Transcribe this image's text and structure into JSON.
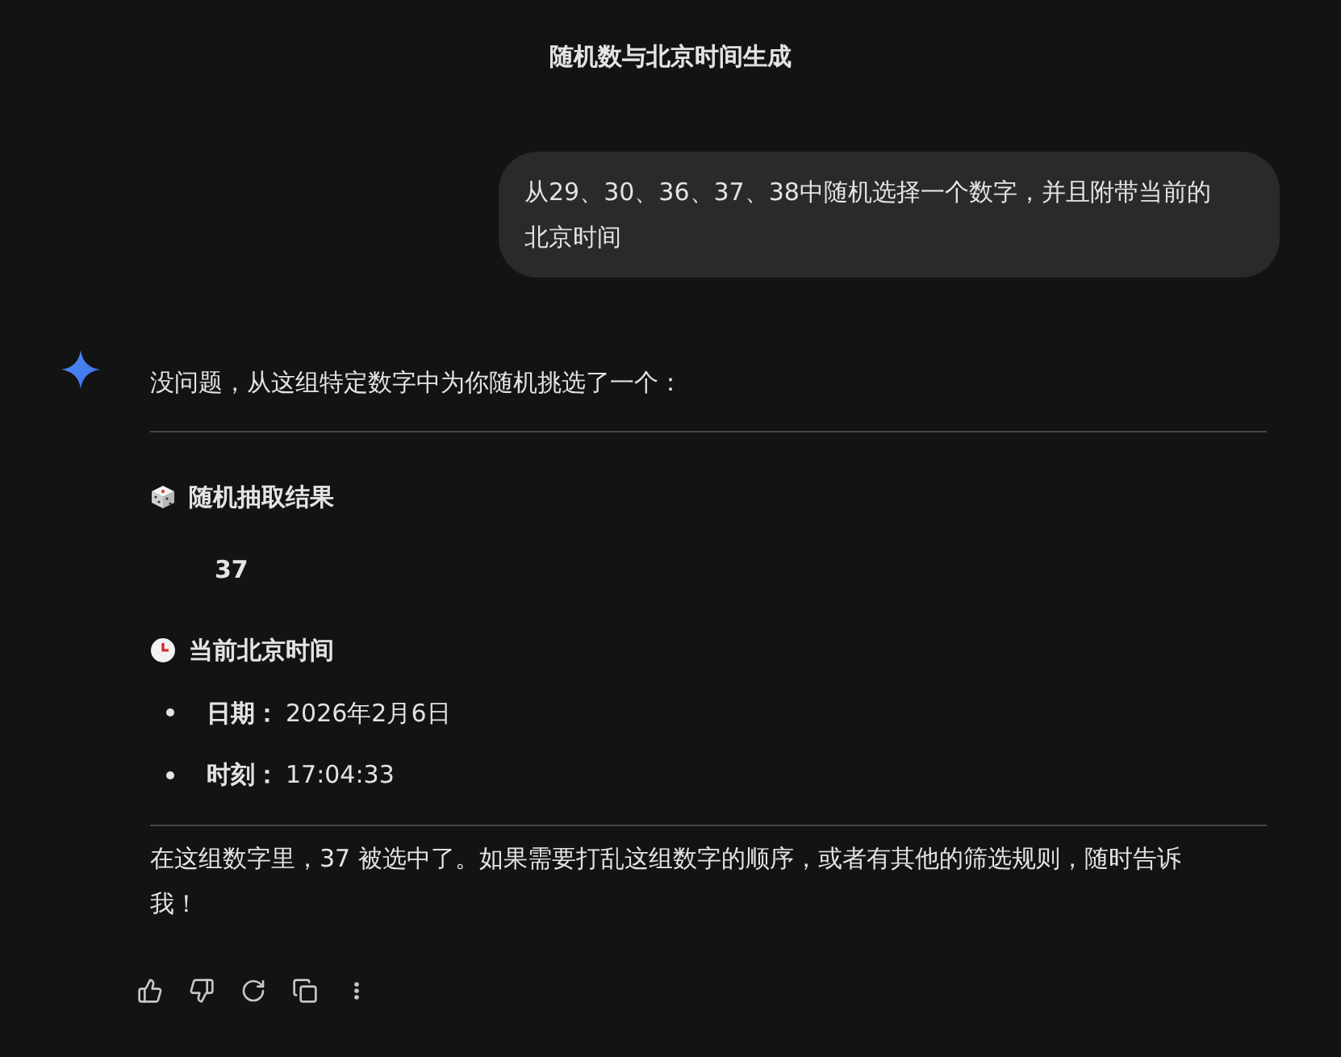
{
  "title": "随机数与北京时间生成",
  "user_message": "从29、30、36、37、38中随机选择一个数字，并且附带当前的北京时间",
  "response": {
    "intro": "没问题，从这组特定数字中为你随机挑选了一个：",
    "sections": [
      {
        "kind": "dice",
        "heading": "随机抽取结果",
        "value": "37"
      },
      {
        "kind": "clock",
        "heading": "当前北京时间",
        "items": [
          {
            "label": "日期：",
            "value": "2026年2月6日"
          },
          {
            "label": "时刻：",
            "value": "17:04:33"
          }
        ]
      }
    ],
    "closing": "在这组数字里，37 被选中了。如果需要打乱这组数字的顺序，或者有其他的筛选规则，随时告诉我！"
  },
  "actions": [
    {
      "kind": "like"
    },
    {
      "kind": "dislike"
    },
    {
      "kind": "regenerate"
    },
    {
      "kind": "copy"
    },
    {
      "kind": "more"
    }
  ]
}
